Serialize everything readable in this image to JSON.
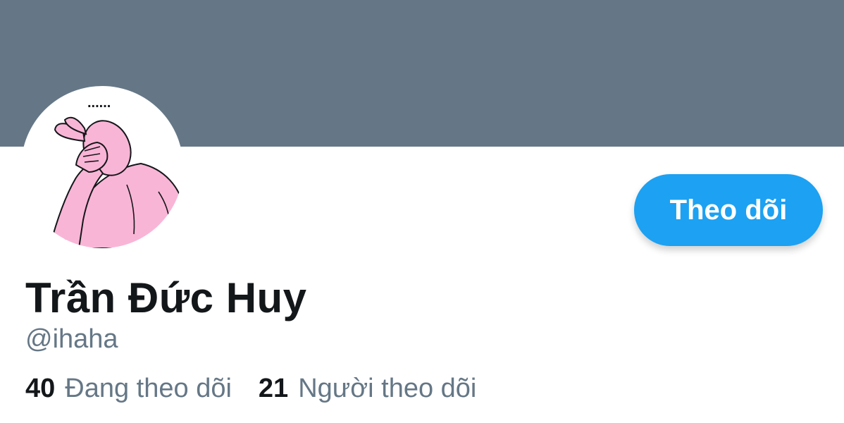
{
  "profile": {
    "name": "Trần Đức Huy",
    "handle": "@ihaha",
    "avatar_dots": "......",
    "follow_button_label": "Theo dõi",
    "stats": {
      "following_count": "40",
      "following_label": "Đang theo dõi",
      "followers_count": "21",
      "followers_label": "Người theo dõi"
    }
  },
  "colors": {
    "cover": "#657786",
    "accent": "#1da1f2",
    "text_primary": "#14171a",
    "text_secondary": "#657786",
    "avatar_skin": "#f9b5d6"
  }
}
